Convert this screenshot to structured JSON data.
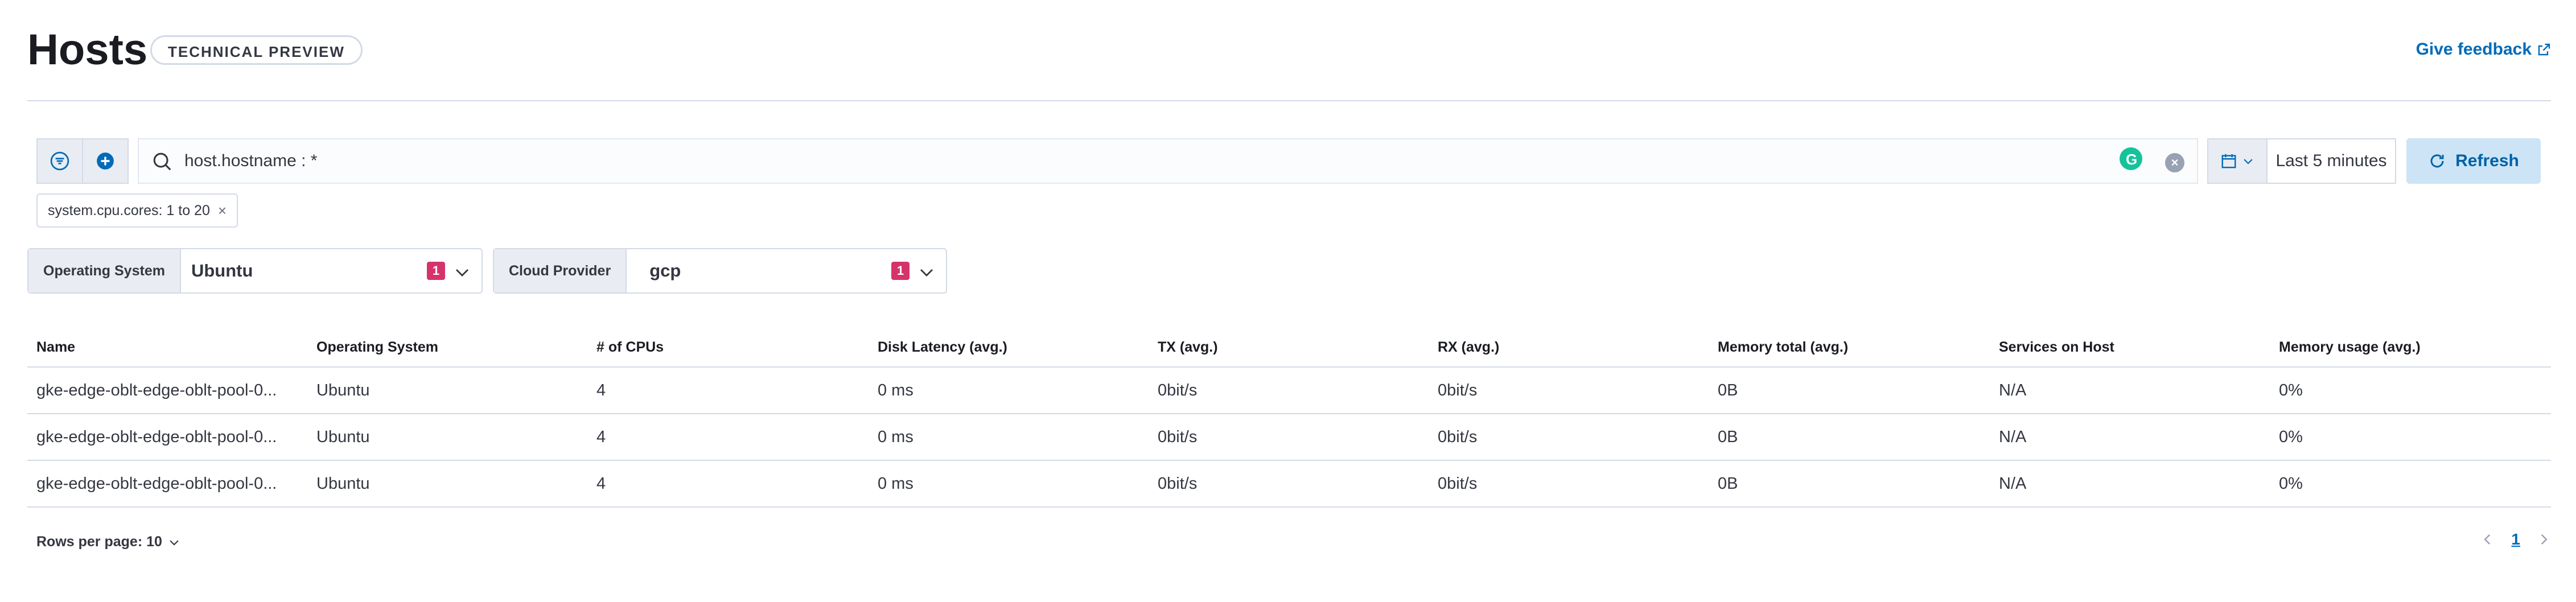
{
  "header": {
    "title": "Hosts",
    "badge": "TECHNICAL PREVIEW",
    "feedback_label": "Give feedback"
  },
  "query_bar": {
    "query": "host.hostname : *",
    "date_range": "Last 5 minutes",
    "refresh_label": "Refresh",
    "filter_pill": "system.cpu.cores: 1 to 20"
  },
  "controls": [
    {
      "label": "Operating System",
      "value": "Ubuntu",
      "count": "1"
    },
    {
      "label": "Cloud Provider",
      "value": "gcp",
      "count": "1"
    }
  ],
  "table": {
    "columns": [
      "Name",
      "Operating System",
      "# of CPUs",
      "Disk Latency (avg.)",
      "TX (avg.)",
      "RX (avg.)",
      "Memory total (avg.)",
      "Services on Host",
      "Memory usage (avg.)"
    ],
    "rows": [
      [
        "gke-edge-oblt-edge-oblt-pool-0...",
        "Ubuntu",
        "4",
        "0 ms",
        "0bit/s",
        "0bit/s",
        "0B",
        "N/A",
        "0%"
      ],
      [
        "gke-edge-oblt-edge-oblt-pool-0...",
        "Ubuntu",
        "4",
        "0 ms",
        "0bit/s",
        "0bit/s",
        "0B",
        "N/A",
        "0%"
      ],
      [
        "gke-edge-oblt-edge-oblt-pool-0...",
        "Ubuntu",
        "4",
        "0 ms",
        "0bit/s",
        "0bit/s",
        "0B",
        "N/A",
        "0%"
      ]
    ]
  },
  "footer": {
    "rows_per_page": "Rows per page: 10",
    "current_page": "1"
  },
  "colors": {
    "accent": "#006bb8",
    "badge_count": "#d5336b",
    "refresh_bg": "#cce4f5"
  }
}
